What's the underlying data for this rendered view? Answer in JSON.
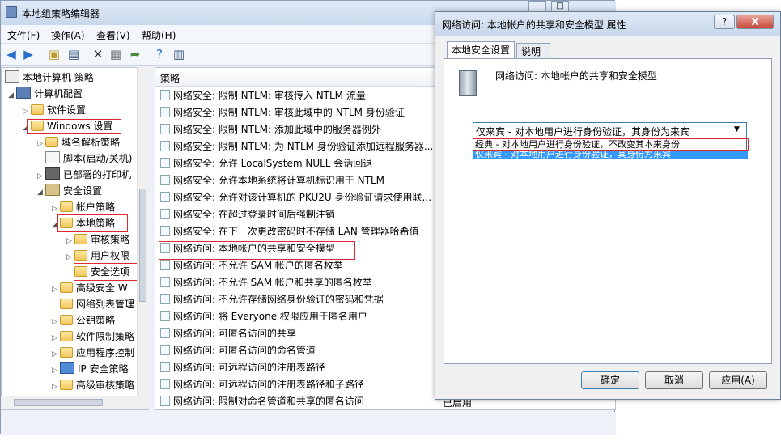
{
  "main_window": {
    "title": "本地组策略编辑器",
    "menus": [
      "文件(F)",
      "操作(A)",
      "查看(V)",
      "帮助(H)"
    ]
  },
  "tree": {
    "items": [
      {
        "label": "本地计算机 策略"
      },
      {
        "label": "计算机配置"
      },
      {
        "label": "软件设置"
      },
      {
        "label": "Windows 设置"
      },
      {
        "label": "域名解析策略"
      },
      {
        "label": "脚本(启动/关机)"
      },
      {
        "label": "已部署的打印机"
      },
      {
        "label": "安全设置"
      },
      {
        "label": "帐户策略"
      },
      {
        "label": "本地策略"
      },
      {
        "label": "审核策略"
      },
      {
        "label": "用户权限"
      },
      {
        "label": "安全选项"
      },
      {
        "label": "高级安全 W"
      },
      {
        "label": "网络列表管理"
      },
      {
        "label": "公钥策略"
      },
      {
        "label": "软件限制策略"
      },
      {
        "label": "应用程序控制"
      },
      {
        "label": "IP 安全策略"
      },
      {
        "label": "高级审核策略"
      }
    ]
  },
  "list": {
    "header": "策略",
    "rows": [
      "网络安全: 限制 NTLM: 审核传入 NTLM 流量",
      "网络安全: 限制 NTLM: 审核此域中的 NTLM 身份验证",
      "网络安全: 限制 NTLM: 添加此域中的服务器例外",
      "网络安全: 限制 NTLM: 为 NTLM 身份验证添加远程服务器...",
      "网络安全: 允许 LocalSystem NULL 会话回退",
      "网络安全: 允许本地系统将计算机标识用于 NTLM",
      "网络安全: 允许对该计算机的 PKU2U 身份验证请求使用联...",
      "网络安全: 在超过登录时间后强制注销",
      "网络安全: 在下一次更改密码时不存储 LAN 管理器哈希值",
      "网络访问: 本地帐户的共享和安全模型",
      "网络访问: 不允许 SAM 帐户的匿名枚举",
      "网络访问: 不允许 SAM 帐户和共享的匿名枚举",
      "网络访问: 不允许存储网络身份验证的密码和凭据",
      "网络访问: 将 Everyone 权限应用于匿名用户",
      "网络访问: 可匿名访问的共享",
      "网络访问: 可匿名访问的命名管道",
      "网络访问: 可远程访问的注册表路径",
      "网络访问: 可远程访问的注册表路径和子路径",
      "网络访问: 限制对命名管道和共享的匿名访问"
    ],
    "last_row_setting": "已启用"
  },
  "dialog": {
    "title": "网络访问: 本地帐户的共享和安全模型 属性",
    "help_btn": "?",
    "close_btn": "X",
    "tabs": [
      "本地安全设置",
      "说明"
    ],
    "policy_name": "网络访问: 本地帐户的共享和安全模型",
    "combo_value": "仅来宾 - 对本地用户进行身份验证，其身份为来宾",
    "options": [
      "经典 - 对本地用户进行身份验证，不改变其本来身份",
      "仅来宾 - 对本地用户进行身份验证，其身份为来宾"
    ],
    "ok": "确定",
    "cancel": "取消",
    "apply": "应用(A)"
  },
  "colors": {
    "highlight": "#3399ff",
    "annotation_red": "#e0262e"
  }
}
